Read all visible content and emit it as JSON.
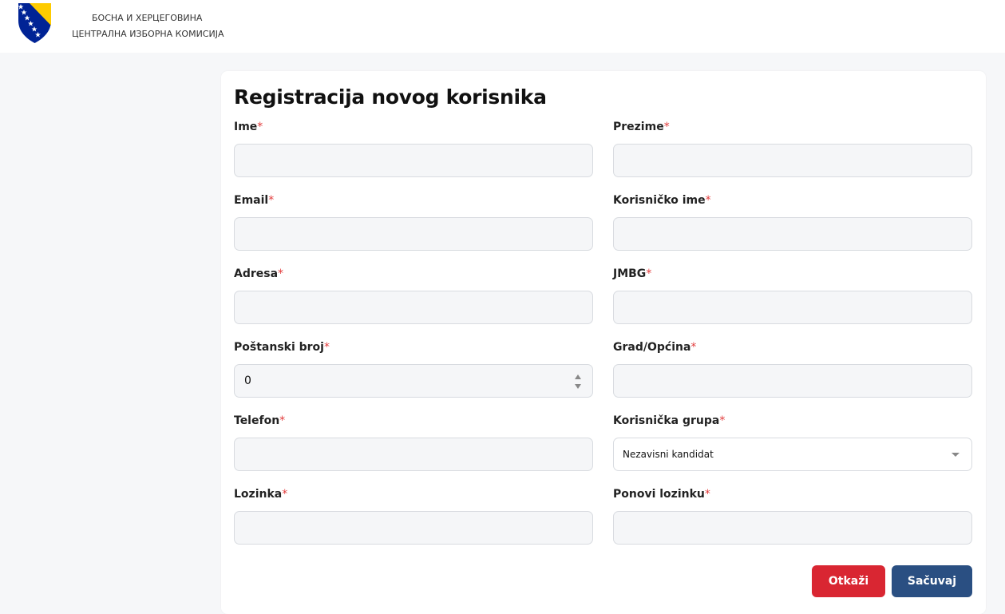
{
  "header": {
    "country_line": "БОСНА И ХЕРЦЕГОВИНА",
    "org_line": "ЦЕНТРАЛНА ИЗБОРНА КОМИСИЈА",
    "coat_of_arms_icon": "bih-coat-of-arms-icon",
    "colors": {
      "shield_blue": "#002395",
      "triangle_yellow": "#FECB00",
      "star_white": "#ffffff"
    }
  },
  "form": {
    "title": "Registracija novog korisnika",
    "required_mark": "*",
    "fields": {
      "ime": {
        "label": "Ime",
        "value": ""
      },
      "prezime": {
        "label": "Prezime",
        "value": ""
      },
      "email": {
        "label": "Email",
        "value": ""
      },
      "korisnicko_ime": {
        "label": "Korisničko ime",
        "value": ""
      },
      "adresa": {
        "label": "Adresa",
        "value": ""
      },
      "jmbg": {
        "label": "JMBG",
        "value": ""
      },
      "postanski_broj": {
        "label": "Poštanski broj",
        "value": "0"
      },
      "grad_opcina": {
        "label": "Grad/Općina",
        "value": ""
      },
      "telefon": {
        "label": "Telefon",
        "value": ""
      },
      "korisnicka_grupa": {
        "label": "Korisnička grupa",
        "value": "Nezavisni kandidat"
      },
      "lozinka": {
        "label": "Lozinka",
        "value": ""
      },
      "ponovi_lozinku": {
        "label": "Ponovi lozinku",
        "value": ""
      }
    },
    "buttons": {
      "cancel": "Otkaži",
      "save": "Sačuvaj"
    },
    "colors": {
      "required": "#e23c3c",
      "cancel_bg": "#d92632",
      "save_bg": "#2a4f82"
    }
  }
}
